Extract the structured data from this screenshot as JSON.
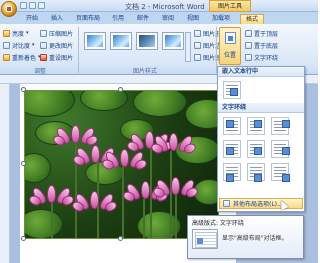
{
  "window": {
    "title": "文档 2 - Microsoft Word",
    "context_tools_label": "图片工具"
  },
  "tabs": [
    "开始",
    "插入",
    "页面布局",
    "引用",
    "邮件",
    "审阅",
    "视图",
    "加载项",
    "格式"
  ],
  "active_tab": "格式",
  "ribbon": {
    "adjust": {
      "items": [
        "亮度",
        "对比度",
        "重新着色",
        "压缩图片",
        "更改图片",
        "重设图片"
      ],
      "group_label": "调整"
    },
    "picture_styles": {
      "group_label": "图片样式",
      "side_items": [
        "图片形状",
        "图片边框",
        "图片效果"
      ]
    },
    "arrange": {
      "position_label": "位置",
      "side_items": [
        "置于顶层",
        "置于底层",
        "文字环绕"
      ]
    }
  },
  "dropdown": {
    "inline_header": "嵌入文本行中",
    "wrap_header": "文字环绕",
    "more_options": "其他布局选项(L)..."
  },
  "tooltip": {
    "title": "高级版式: 文字环绕",
    "text": "显示\"高级布局\"对话框。"
  }
}
